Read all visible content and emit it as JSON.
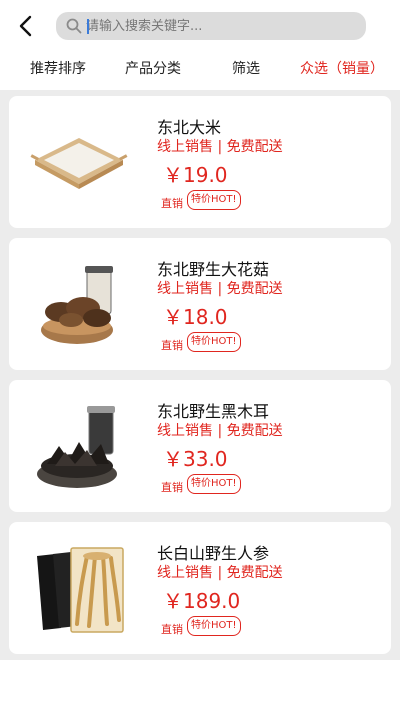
{
  "header": {
    "search_placeholder": "请输入搜索关键字..."
  },
  "filters": [
    {
      "label": "推荐排序"
    },
    {
      "label": "产品分类"
    },
    {
      "label": "筛选"
    },
    {
      "label": "众选（销量）",
      "active": true
    }
  ],
  "products": [
    {
      "name": "东北大米",
      "tags": "线上销售 | 免费配送",
      "price": "￥19.0",
      "channel": "直销",
      "badge": "特价HOT!",
      "image": "rice-image"
    },
    {
      "name": "东北野生大花菇",
      "tags": "线上销售 | 免费配送",
      "price": "￥18.0",
      "channel": "直销",
      "badge": "特价HOT!",
      "image": "mushroom-image"
    },
    {
      "name": "东北野生黑木耳",
      "tags": "线上销售 | 免费配送",
      "price": "￥33.0",
      "channel": "直销",
      "badge": "特价HOT!",
      "image": "black-fungus-image"
    },
    {
      "name": "长白山野生人参",
      "tags": "线上销售 | 免费配送",
      "price": "￥189.0",
      "channel": "直销",
      "badge": "特价HOT!",
      "image": "ginseng-image"
    }
  ],
  "colors": {
    "accent": "#e0261f",
    "list_background": "#ececec",
    "search_background": "#dcdcdc"
  }
}
